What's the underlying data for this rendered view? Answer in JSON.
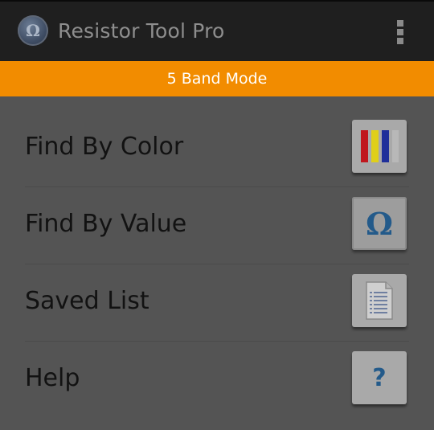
{
  "app": {
    "title": "Resistor Tool Pro",
    "icon": "omega-app-icon",
    "icon_glyph": "Ω"
  },
  "mode_banner": {
    "text": "5 Band Mode",
    "color": "#f28c00"
  },
  "menu": {
    "items": [
      {
        "label": "Find By Color",
        "icon": "color-bands-icon"
      },
      {
        "label": "Find By Value",
        "icon": "omega-icon",
        "glyph": "Ω"
      },
      {
        "label": "Saved List",
        "icon": "document-list-icon"
      },
      {
        "label": "Help",
        "icon": "help-icon",
        "glyph": "?"
      }
    ]
  },
  "colors": {
    "toolbar": "#1f1f1f",
    "background": "#545454",
    "band_colors": [
      "#c0171d",
      "#e0cf1a",
      "#1f2f9a",
      "#b0b0b0"
    ]
  }
}
